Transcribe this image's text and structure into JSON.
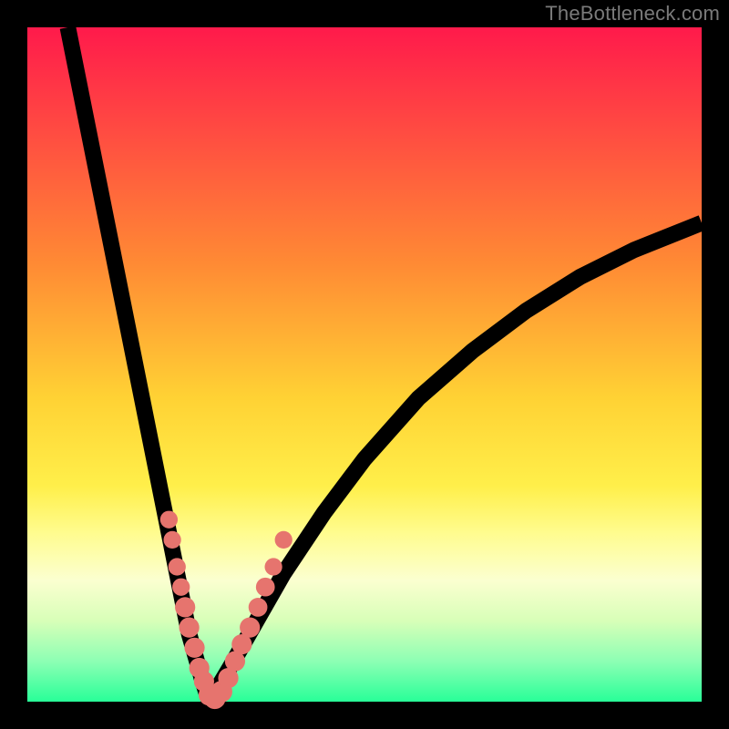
{
  "watermark": "TheBottleneck.com",
  "colors": {
    "frame": "#000000",
    "curve": "#000000",
    "bead": "#e6746e",
    "gradient_stops": [
      "#ff1a4b",
      "#ff4a42",
      "#ff8a34",
      "#ffd234",
      "#ffef4a",
      "#fffc8f",
      "#fbffd0",
      "#d8ffb8",
      "#8dffb4",
      "#28ff98"
    ]
  },
  "chart_data": {
    "type": "line",
    "title": "",
    "xlabel": "",
    "ylabel": "",
    "xlim": [
      0,
      100
    ],
    "ylim": [
      0,
      100
    ],
    "x_min_point": 27,
    "left_curve": {
      "x": [
        6,
        8,
        10,
        12,
        14,
        16,
        18,
        20,
        22,
        24,
        26,
        27
      ],
      "y": [
        100,
        90,
        80,
        70,
        60,
        50,
        40,
        30,
        20,
        10,
        3,
        0
      ]
    },
    "right_curve": {
      "x": [
        27,
        30,
        34,
        38,
        44,
        50,
        58,
        66,
        74,
        82,
        90,
        100
      ],
      "y": [
        0,
        5,
        12,
        19,
        28,
        36,
        45,
        52,
        58,
        63,
        67,
        71
      ]
    },
    "series": [
      {
        "name": "bottleneck-curve-left",
        "x": [
          6,
          8,
          10,
          12,
          14,
          16,
          18,
          20,
          22,
          24,
          26,
          27
        ],
        "y": [
          100,
          90,
          80,
          70,
          60,
          50,
          40,
          30,
          20,
          10,
          3,
          0
        ]
      },
      {
        "name": "bottleneck-curve-right",
        "x": [
          27,
          30,
          34,
          38,
          44,
          50,
          58,
          66,
          74,
          82,
          90,
          100
        ],
        "y": [
          0,
          5,
          12,
          19,
          28,
          36,
          45,
          52,
          58,
          63,
          67,
          71
        ]
      }
    ],
    "beads": [
      {
        "x": 21.0,
        "y": 27,
        "r": 1.3
      },
      {
        "x": 21.5,
        "y": 24,
        "r": 1.3
      },
      {
        "x": 22.2,
        "y": 20,
        "r": 1.3
      },
      {
        "x": 22.8,
        "y": 17,
        "r": 1.3
      },
      {
        "x": 23.4,
        "y": 14,
        "r": 1.5
      },
      {
        "x": 24.0,
        "y": 11,
        "r": 1.5
      },
      {
        "x": 24.8,
        "y": 8,
        "r": 1.5
      },
      {
        "x": 25.5,
        "y": 5,
        "r": 1.5
      },
      {
        "x": 26.2,
        "y": 3,
        "r": 1.5
      },
      {
        "x": 27.0,
        "y": 1,
        "r": 1.6
      },
      {
        "x": 27.8,
        "y": 0.5,
        "r": 1.6
      },
      {
        "x": 28.8,
        "y": 1.5,
        "r": 1.6
      },
      {
        "x": 29.8,
        "y": 3.5,
        "r": 1.5
      },
      {
        "x": 30.8,
        "y": 6,
        "r": 1.5
      },
      {
        "x": 31.8,
        "y": 8.5,
        "r": 1.5
      },
      {
        "x": 33.0,
        "y": 11,
        "r": 1.5
      },
      {
        "x": 34.2,
        "y": 14,
        "r": 1.4
      },
      {
        "x": 35.3,
        "y": 17,
        "r": 1.4
      },
      {
        "x": 36.5,
        "y": 20,
        "r": 1.3
      },
      {
        "x": 38.0,
        "y": 24,
        "r": 1.3
      }
    ]
  }
}
